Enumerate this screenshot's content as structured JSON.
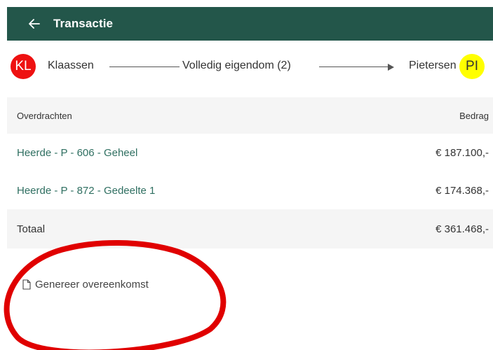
{
  "header": {
    "back_icon": "arrow-left-icon",
    "title": "Transactie"
  },
  "transfer": {
    "from": {
      "initials": "KL",
      "name": "Klaassen",
      "color": "#ee1111"
    },
    "to": {
      "initials": "PI",
      "name": "Pietersen",
      "color": "#ffff00"
    },
    "type_label": "Volledig eigendom (2)"
  },
  "table": {
    "columns": [
      "Overdrachten",
      "Bedrag"
    ],
    "rows": [
      {
        "parcel": "Heerde - P - 606 - Geheel",
        "amount": "€ 187.100,-"
      },
      {
        "parcel": "Heerde - P - 872 - Gedeelte 1",
        "amount": "€ 174.368,-"
      }
    ],
    "total_label": "Totaal",
    "total_amount": "€ 361.468,-"
  },
  "actions": {
    "generate_label": "Genereer overeenkomst",
    "generate_icon": "document-icon"
  },
  "colors": {
    "header_bg": "#23564a",
    "link": "#2f6f61",
    "annotation": "#e00000"
  }
}
